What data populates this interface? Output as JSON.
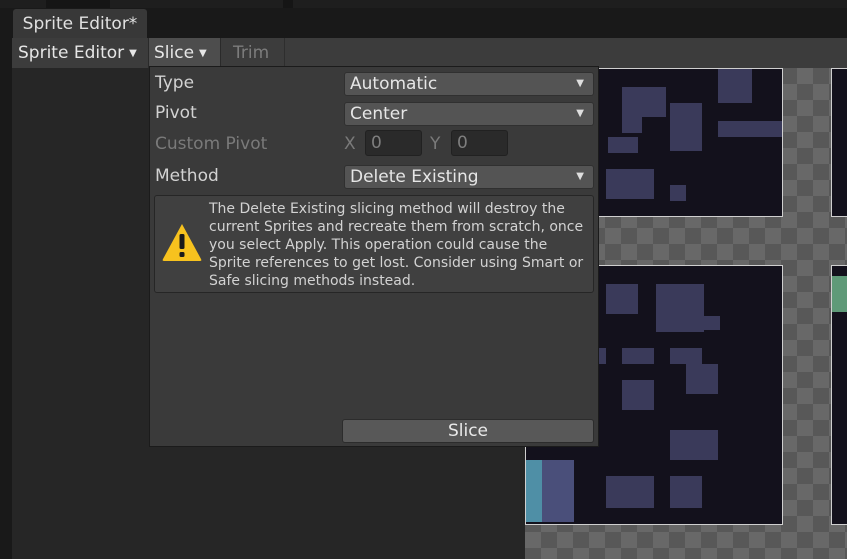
{
  "window": {
    "tab_title": "Sprite Editor*"
  },
  "toolbar": {
    "mode_label": "Sprite Editor",
    "slice_label": "Slice",
    "trim_label": "Trim"
  },
  "slice_popup": {
    "type": {
      "label": "Type",
      "value": "Automatic"
    },
    "pivot": {
      "label": "Pivot",
      "value": "Center"
    },
    "custom_pivot": {
      "label": "Custom Pivot",
      "x_label": "X",
      "x_value": "0",
      "y_label": "Y",
      "y_value": "0"
    },
    "method": {
      "label": "Method",
      "value": "Delete Existing"
    },
    "warning": "The Delete Existing slicing method will destroy the current Sprites and recreate them from scratch, once you select Apply. This operation could cause the Sprite references to get lost. Consider using Smart or Safe slicing methods instead.",
    "slice_button": "Slice"
  },
  "icons": {
    "dropdown": "triangle-down-icon",
    "warning": "warning-triangle-icon"
  },
  "colors": {
    "popup_bg": "#3a3a3a",
    "warning_icon": "#f7c21e",
    "sprite_bg": "#13111c",
    "sprite_block": "#3a3a5a"
  }
}
